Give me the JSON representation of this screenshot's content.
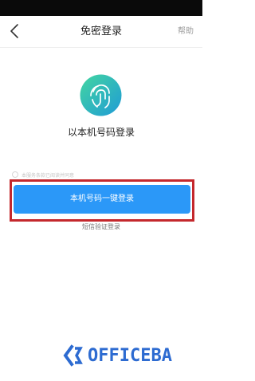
{
  "nav": {
    "back_icon": "chevron-left-icon",
    "title": "免密登录",
    "help_label": "帮助"
  },
  "main": {
    "logo_icon": "fingerprint-icon",
    "headline": "以本机号码登录",
    "agreement_text": "本服务条款已阅读并同意",
    "onekey_button_label": "本机号码一键登录",
    "sms_login_label": "短信验证登录"
  },
  "watermark": {
    "text": "OFFICEBA",
    "icon": "officeba-logo-icon"
  },
  "colors": {
    "status_bar": "#0a0a0a",
    "primary_button": "#2b98f8",
    "highlight_border": "#c4282d",
    "logo_gradient_start": "#43d6a0",
    "logo_gradient_end": "#1f9bd6",
    "watermark": "#2d6bd1"
  }
}
